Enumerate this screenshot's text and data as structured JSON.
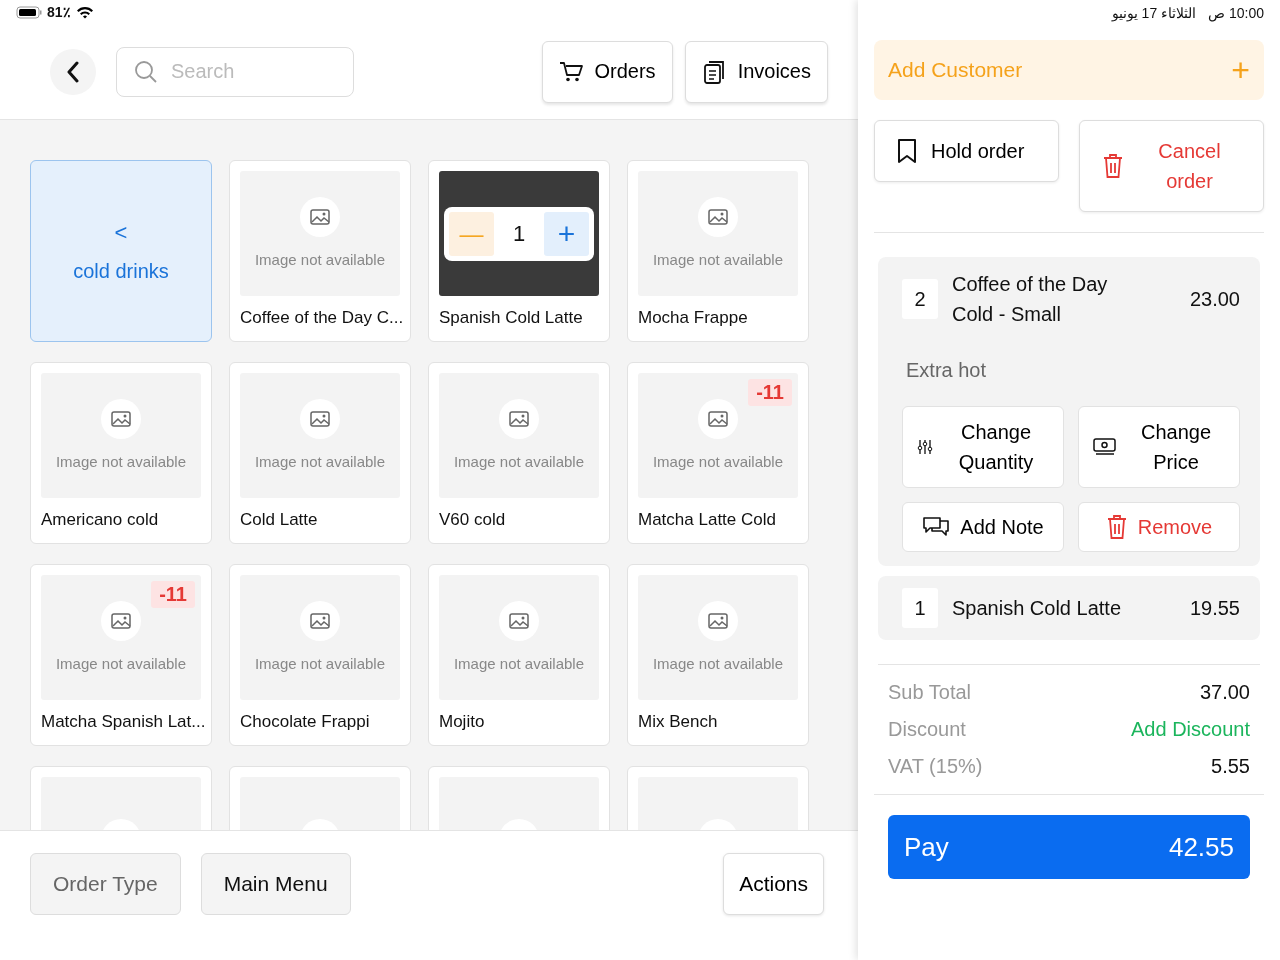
{
  "status_bar": {
    "battery": "81٪",
    "time": "10:00 ص",
    "date": "الثلاثاء 17 يونيو"
  },
  "header": {
    "search": {
      "placeholder": "Search"
    },
    "buttons": [
      {
        "kind": "orders",
        "label": "Orders"
      },
      {
        "kind": "invoices",
        "label": "Invoices"
      }
    ]
  },
  "products": [
    {
      "kind": "category",
      "name": "cold drinks",
      "glyph": "<"
    },
    {
      "kind": "product",
      "name": "Coffee of the Day C...",
      "image_text": "Image not available"
    },
    {
      "kind": "stepper",
      "name": "Spanish Cold Latte",
      "quantity": "1",
      "minus": "—",
      "plus": "+"
    },
    {
      "kind": "product",
      "name": "Mocha Frappe",
      "image_text": "Image not available"
    },
    {
      "kind": "product",
      "name": "Americano cold",
      "image_text": "Image not available"
    },
    {
      "kind": "product",
      "name": "Cold Latte",
      "image_text": "Image not available"
    },
    {
      "kind": "product",
      "name": "V60 cold",
      "image_text": "Image not available"
    },
    {
      "kind": "product",
      "name": "Matcha Latte Cold",
      "image_text": "Image not available",
      "badge": "-11"
    },
    {
      "kind": "product",
      "name": "Matcha Spanish Lat...",
      "image_text": "Image not available",
      "badge": "-11"
    },
    {
      "kind": "product",
      "name": "Chocolate Frappi",
      "image_text": "Image not available"
    },
    {
      "kind": "product",
      "name": "Mojito",
      "image_text": "Image not available"
    },
    {
      "kind": "product",
      "name": "Mix Bench",
      "image_text": "Image not available"
    },
    {
      "kind": "cut"
    },
    {
      "kind": "cut"
    },
    {
      "kind": "cut"
    },
    {
      "kind": "cut"
    }
  ],
  "bottom_bar": [
    {
      "kind": "muted",
      "label": "Order Type"
    },
    {
      "kind": "filled",
      "label": "Main Menu"
    },
    {
      "kind": "outline",
      "label": "Actions"
    }
  ],
  "customer": {
    "label": "Add Customer",
    "icon": "+"
  },
  "order_buttons": [
    {
      "kind": "hold",
      "label": "Hold order"
    },
    {
      "kind": "cancel",
      "label": "Cancel order"
    }
  ],
  "lines": [
    {
      "qty": "2",
      "name": "Coffee of the Day Cold - Small",
      "price": "23.00",
      "expanded": true,
      "note": "Extra hot",
      "actions": [
        {
          "kind": "quantity",
          "label": "Change Quantity"
        },
        {
          "kind": "price",
          "label": "Change Price"
        },
        {
          "kind": "note",
          "label": "Add Note"
        },
        {
          "kind": "remove",
          "label": "Remove"
        }
      ]
    },
    {
      "qty": "1",
      "name": "Spanish Cold Latte",
      "price": "19.55",
      "expanded": false
    }
  ],
  "totals": [
    {
      "kind": "amount",
      "label": "Sub Total",
      "value": "37.00"
    },
    {
      "kind": "link",
      "label": "Discount",
      "value": "Add Discount"
    },
    {
      "kind": "amount",
      "label": "VAT (15%)",
      "value": "5.55"
    }
  ],
  "pay": {
    "label": "Pay",
    "amount": "42.55"
  }
}
